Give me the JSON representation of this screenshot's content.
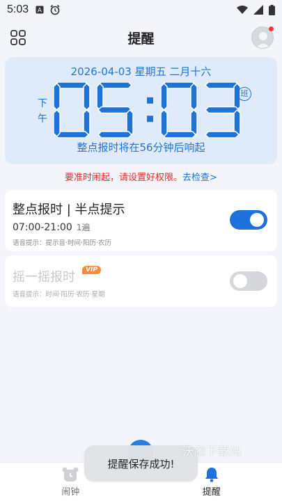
{
  "status_bar": {
    "time": "5:03",
    "left_icons": [
      "a-box-icon",
      "alarm-clock-icon"
    ],
    "right_icons": [
      "wifi-icon",
      "signal-icon",
      "battery-icon"
    ]
  },
  "header": {
    "title": "提醒"
  },
  "clock": {
    "date_line": "2026-04-03 星期五 二月十六",
    "ampm": "下午",
    "time": "05:03",
    "badge": "班",
    "next_chime": "整点报时将在56分钟后响起"
  },
  "warning": {
    "text": "要准时闹起，请设置好权限。",
    "link": "去检查>"
  },
  "cards": [
    {
      "title": "整点报时 | 半点提示",
      "time_range": "07:00-21:00",
      "repeat": "1遍",
      "voice_tip": "语音提示：提示音·时间·阳历·农历",
      "enabled": true
    },
    {
      "title": "摇一摇报时",
      "vip_badge": "VIP",
      "voice_tip": "语音提示：时间·阳历·农历·星期",
      "enabled": false
    }
  ],
  "tabbar": {
    "tabs": [
      {
        "label": "闹钟",
        "icon": "alarm-clock-tab-icon",
        "active": false
      },
      {
        "label": "提醒",
        "icon": "bell-tab-icon",
        "active": true
      }
    ]
  },
  "toast": {
    "text": "提醒保存成功!"
  },
  "watermark": {
    "text": "沃騰下载站"
  },
  "colors": {
    "accent": "#1f6fdc",
    "clock_blue": "#1f73d6",
    "card_bg": "#dfeafb",
    "warning_red": "#e02a2a",
    "vip_orange": "#ff8a3d"
  }
}
